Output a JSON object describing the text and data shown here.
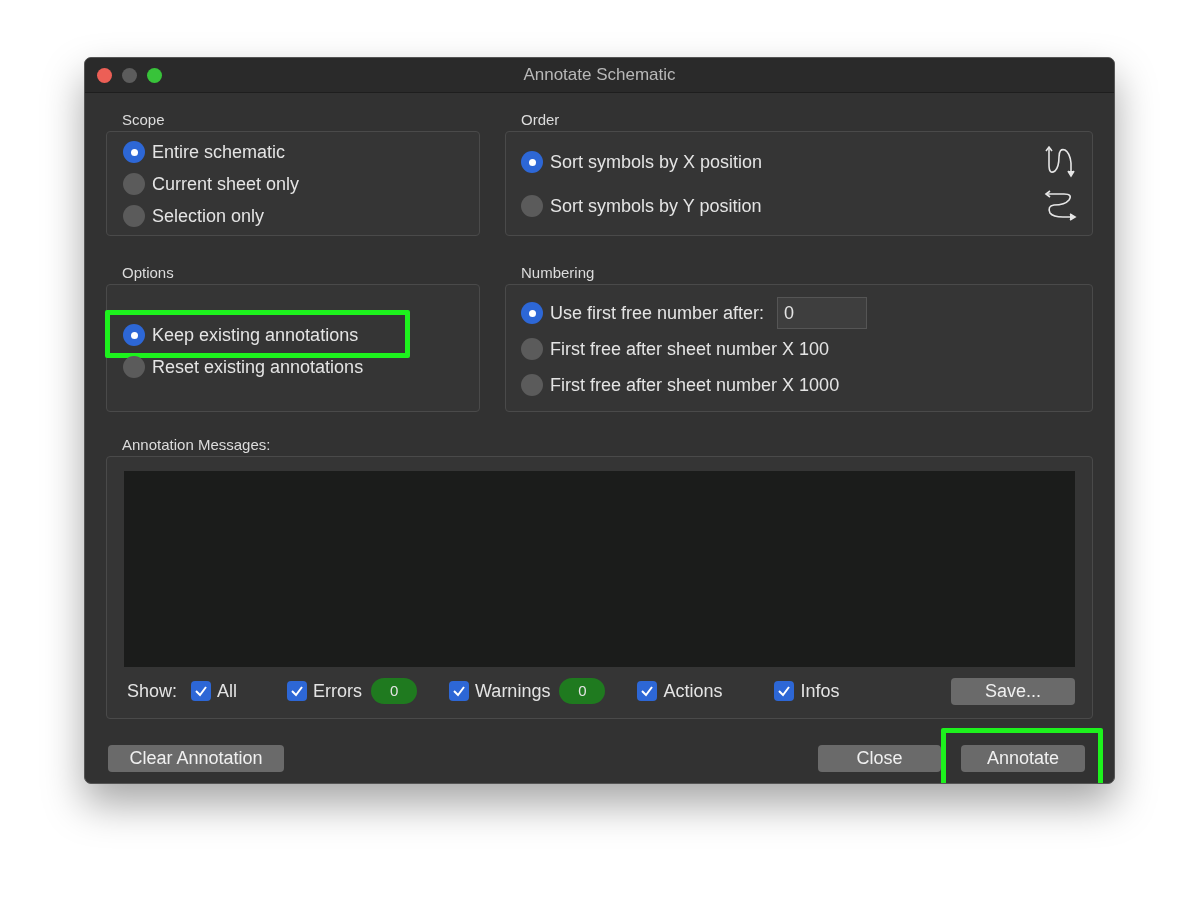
{
  "window": {
    "title": "Annotate Schematic"
  },
  "scope": {
    "label": "Scope",
    "items": [
      {
        "label": "Entire schematic",
        "selected": true
      },
      {
        "label": "Current sheet only",
        "selected": false
      },
      {
        "label": "Selection only",
        "selected": false
      }
    ]
  },
  "order": {
    "label": "Order",
    "items": [
      {
        "label": "Sort symbols by X position",
        "selected": true,
        "kind": "x"
      },
      {
        "label": "Sort symbols by Y position",
        "selected": false,
        "kind": "y"
      }
    ]
  },
  "options": {
    "label": "Options",
    "items": [
      {
        "label": "Keep existing annotations",
        "selected": true,
        "highlighted": true
      },
      {
        "label": "Reset existing annotations",
        "selected": false,
        "highlighted": false
      }
    ]
  },
  "numbering": {
    "label": "Numbering",
    "items": [
      {
        "label": "Use first free number after:",
        "selected": true,
        "value": "0"
      },
      {
        "label": "First free after sheet number X 100",
        "selected": false
      },
      {
        "label": "First free after sheet number X 1000",
        "selected": false
      }
    ]
  },
  "messages": {
    "label": "Annotation Messages:",
    "show_label": "Show:",
    "filters": [
      {
        "label": "All",
        "checked": true
      },
      {
        "label": "Errors",
        "checked": true,
        "count": "0"
      },
      {
        "label": "Warnings",
        "checked": true,
        "count": "0"
      },
      {
        "label": "Actions",
        "checked": true
      },
      {
        "label": "Infos",
        "checked": true
      }
    ],
    "save_button": "Save..."
  },
  "buttons": [
    {
      "label": "Clear Annotation",
      "highlighted": false
    },
    {
      "label": "Close",
      "highlighted": false
    },
    {
      "label": "Annotate",
      "highlighted": true
    }
  ]
}
